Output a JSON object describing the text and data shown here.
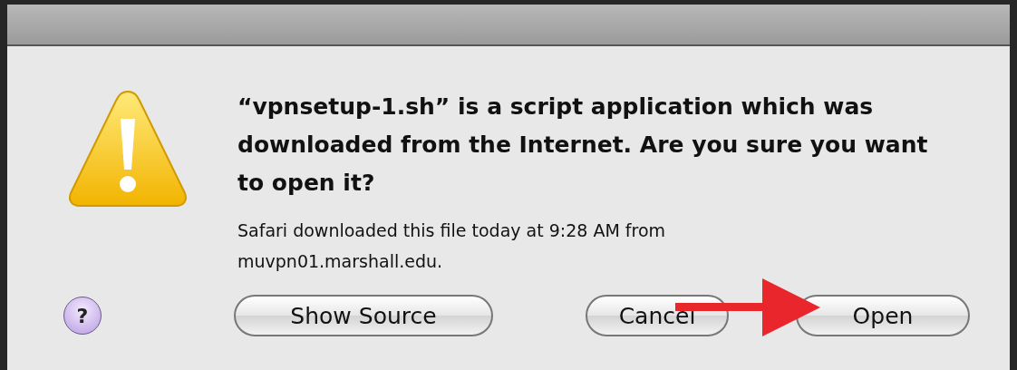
{
  "dialog": {
    "headline": "“vpnsetup-1.sh” is a script application which was downloaded from the Internet. Are you sure you want to open it?",
    "message": "Safari downloaded this file today at 9:28 AM from muvpn01.marshall.edu.",
    "help": "?",
    "buttons": [
      {
        "label": "Show Source",
        "kind": "left"
      },
      {
        "label": "Cancel",
        "kind": "right"
      },
      {
        "label": "Open",
        "kind": "right"
      }
    ]
  }
}
